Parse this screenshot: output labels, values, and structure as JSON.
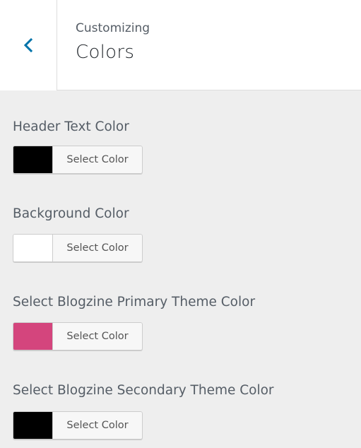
{
  "header": {
    "subtitle": "Customizing",
    "title": "Colors",
    "back_icon": "chevron-left-icon",
    "accent": "#0073aa"
  },
  "controls": [
    {
      "label": "Header Text Color",
      "swatch_color": "#000000",
      "button_label": "Select Color"
    },
    {
      "label": "Background Color",
      "swatch_color": "#ffffff",
      "button_label": "Select Color"
    },
    {
      "label": "Select Blogzine Primary Theme Color",
      "swatch_color": "#d4457d",
      "button_label": "Select Color"
    },
    {
      "label": "Select Blogzine Secondary Theme Color",
      "swatch_color": "#000000",
      "button_label": "Select Color"
    }
  ]
}
